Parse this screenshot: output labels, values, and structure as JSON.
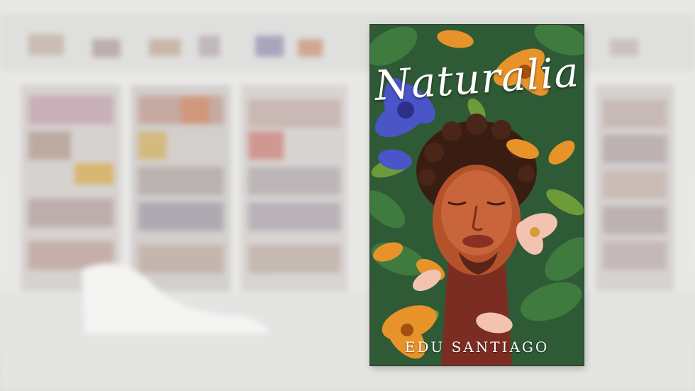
{
  "book": {
    "title": "Naturalia",
    "author": "EDU SANTIAGO"
  },
  "colors": {
    "background": "#e9e9e7",
    "cover_foliage": "#2f5a36",
    "flower_orange": "#e8932a",
    "flower_blue": "#4a55c8",
    "skin": "#b5522c",
    "hair": "#3a1d12"
  }
}
